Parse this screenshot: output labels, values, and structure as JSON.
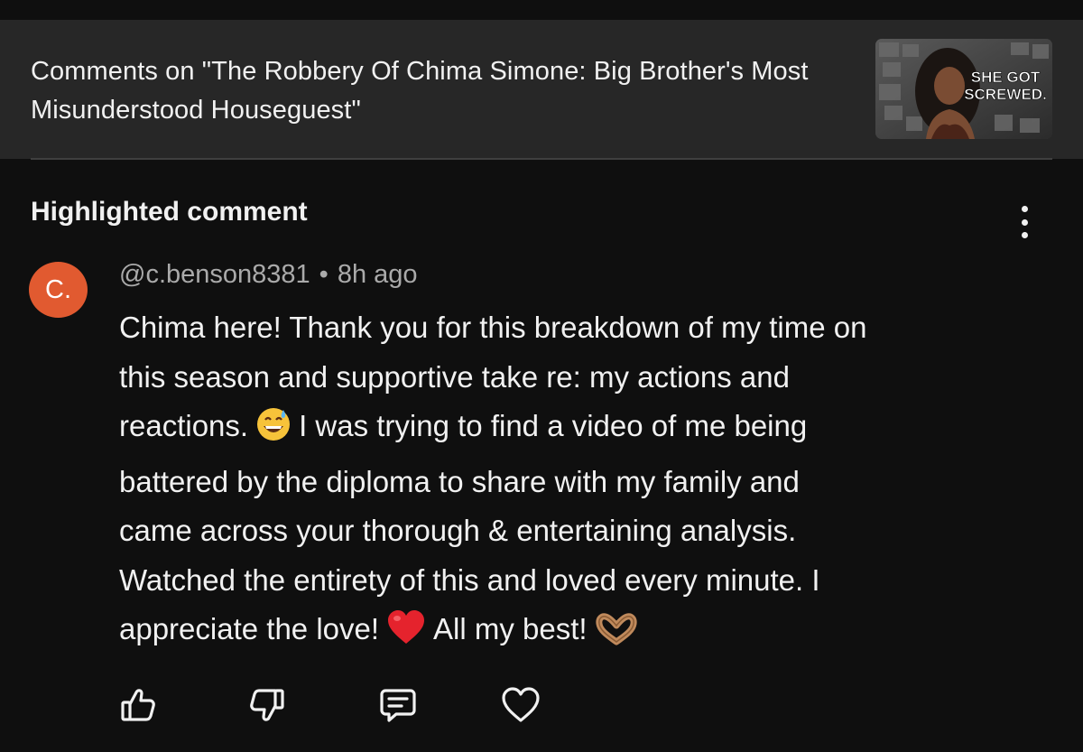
{
  "header": {
    "title": "Comments on \"The Robbery Of Chima Simone: Big Brother's Most Misunderstood Houseguest\"",
    "thumbnail": {
      "text_line1": "SHE GOT",
      "text_line2": "SCREWED."
    }
  },
  "section": {
    "title": "Highlighted comment",
    "menu_icon": "vertical-ellipsis-icon"
  },
  "comment": {
    "avatar_letter": "C.",
    "avatar_color": "#e15a30",
    "author": "@c.benson8381",
    "separator": "•",
    "time": "8h ago",
    "lines": [
      "Chima here! Thank you for this breakdown of my time on",
      "this season and supportive take re: my actions and",
      "reactions.",
      "I was trying to find a video of me being",
      "battered by the diploma to share with my family and",
      "came across your thorough & entertaining analysis.",
      "Watched the entirety of this and loved every minute. I",
      "appreciate the love!",
      "All my best!"
    ]
  },
  "actions": [
    "like-icon",
    "dislike-icon",
    "reply-icon",
    "heart-icon"
  ]
}
